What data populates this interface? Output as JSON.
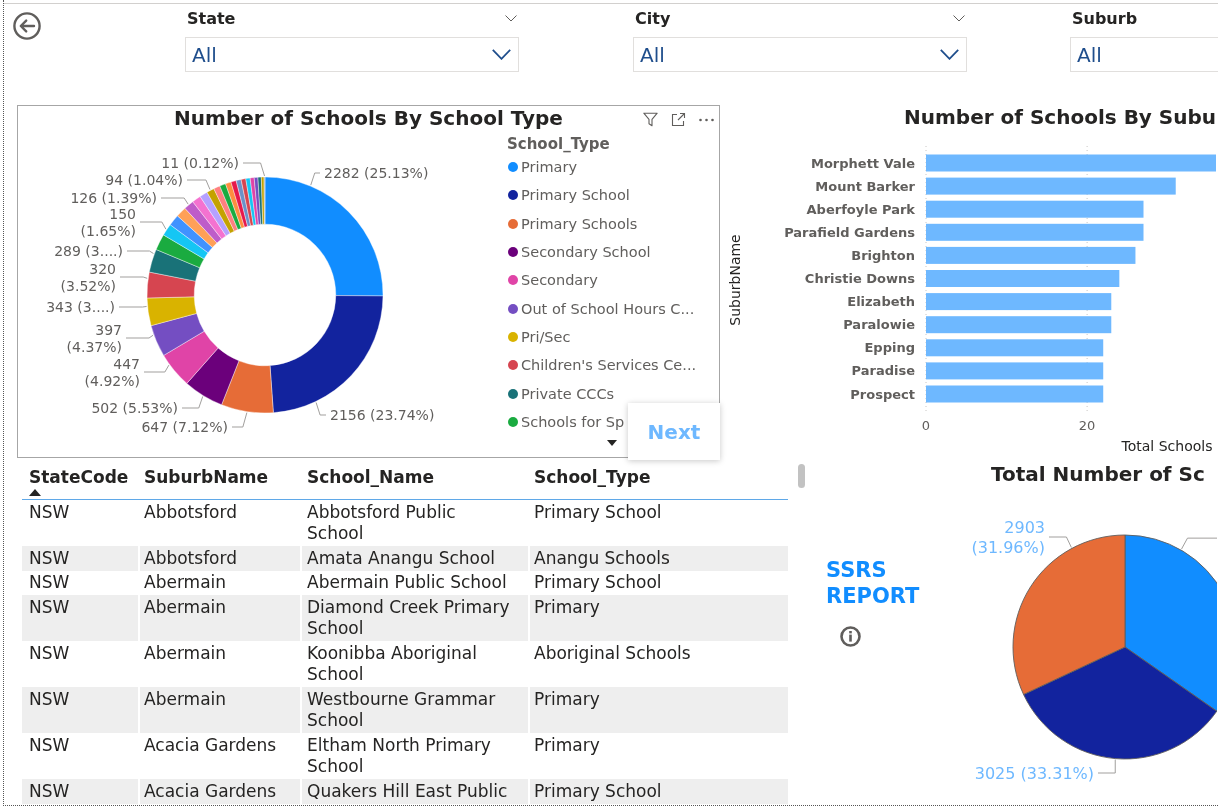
{
  "slicers": [
    {
      "label": "State",
      "value": "All"
    },
    {
      "label": "City",
      "value": "All"
    },
    {
      "label": "Suburb",
      "value": "All"
    }
  ],
  "school_type_chart": {
    "legend_title": "School_Type",
    "legend": [
      {
        "label": "Primary",
        "color": "#118dff"
      },
      {
        "label": "Primary School",
        "color": "#12239e"
      },
      {
        "label": "Primary Schools",
        "color": "#e66c37"
      },
      {
        "label": "Secondary School",
        "color": "#6b007b"
      },
      {
        "label": "Secondary",
        "color": "#e044a7"
      },
      {
        "label": "Out of School Hours C...",
        "color": "#744ec2"
      },
      {
        "label": "Pri/Sec",
        "color": "#d9b300"
      },
      {
        "label": "Children's Services Ce...",
        "color": "#d64550"
      },
      {
        "label": "Private CCCs",
        "color": "#197278"
      },
      {
        "label": "Schools for Sp",
        "color": "#1aab40"
      }
    ],
    "legend_tooltip": "Next",
    "chart_data": {
      "type": "donut",
      "title": "Number of Schools By School Type",
      "values": [
        2282,
        2156,
        647,
        502,
        447,
        397,
        343,
        320,
        289,
        200,
        150,
        140,
        130,
        126,
        110,
        100,
        94,
        80,
        75,
        70,
        66,
        62,
        58,
        54,
        50,
        46,
        42,
        34,
        11
      ],
      "value_labels": [
        "2282 (25.13%)",
        "2156 (23.74%)",
        "647 (7.12%)",
        "502 (5.53%)",
        "447 (4.92%)",
        "397 (4.37%)",
        "343 (3....)",
        "320 (3.52%)",
        "289 (3....)",
        null,
        "150 (1.65%)",
        null,
        null,
        "126 (1.39%)",
        null,
        null,
        "94 (1.04%)",
        null,
        null,
        null,
        null,
        null,
        null,
        null,
        null,
        null,
        null,
        null,
        "11 (0.12%)"
      ]
    }
  },
  "suburb_chart": {
    "chart_data": {
      "type": "bar",
      "orientation": "horizontal",
      "title": "Number of Schools By Subu",
      "xlabel": "Total Schools",
      "ylabel": "SuburbName",
      "categories": [
        "Morphett Vale",
        "Mount Barker",
        "Aberfoyle Park",
        "Parafield Gardens",
        "Brighton",
        "Christie Downs",
        "Elizabeth",
        "Paralowie",
        "Epping",
        "Paradise",
        "Prospect"
      ],
      "values": [
        36,
        31,
        27,
        27,
        26,
        24,
        23,
        23,
        22,
        22,
        22
      ],
      "xlim": [
        0,
        36
      ],
      "xticks": [
        0,
        20
      ]
    }
  },
  "table": {
    "columns": [
      {
        "label": "StateCode",
        "sorted": true
      },
      {
        "label": "SuburbName",
        "sorted": false
      },
      {
        "label": "School_Name",
        "sorted": false
      },
      {
        "label": "School_Type",
        "sorted": false
      }
    ],
    "rows": [
      [
        "NSW",
        "Abbotsford",
        "Abbotsford Public School",
        "Primary School"
      ],
      [
        "NSW",
        "Abbotsford",
        "Amata Anangu School",
        "Anangu Schools"
      ],
      [
        "NSW",
        "Abermain",
        "Abermain Public School",
        "Primary School"
      ],
      [
        "NSW",
        "Abermain",
        "Diamond Creek Primary School",
        "Primary"
      ],
      [
        "NSW",
        "Abermain",
        "Koonibba Aboriginal School",
        "Aboriginal Schools"
      ],
      [
        "NSW",
        "Abermain",
        "Westbourne Grammar School",
        "Primary"
      ],
      [
        "NSW",
        "Acacia Gardens",
        "Eltham North Primary School",
        "Primary"
      ],
      [
        "NSW",
        "Acacia Gardens",
        "Quakers Hill East Public",
        "Primary School"
      ]
    ]
  },
  "report_link": {
    "label": "SSRS REPORT"
  },
  "total_chart": {
    "chart_data": {
      "type": "pie",
      "title": "Total Number of Sc",
      "values": [
        3153,
        3025,
        2903
      ],
      "value_labels": [
        null,
        "3025 (33.31%)",
        "2903 (31.96%)"
      ]
    }
  }
}
